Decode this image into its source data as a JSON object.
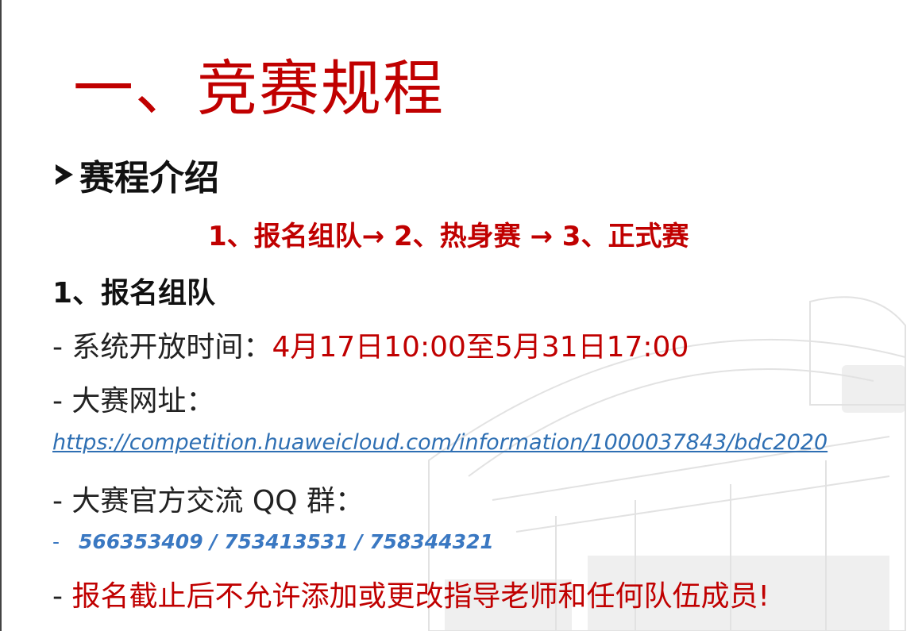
{
  "slide": {
    "title": "一、竞赛规程",
    "section_heading": "赛程介绍",
    "flow": "1、报名组队→ 2、热身赛 → 3、正式赛",
    "sub_heading": "1、报名组队",
    "open_time_label": "- 系统开放时间：",
    "open_time_value": "4月17日10:00至5月31日17:00",
    "site_label": "- 大赛网址：",
    "site_url": "https://competition.huaweicloud.com/information/1000037843/bdc2020",
    "qq_label": "- 大赛官方交流 QQ 群：",
    "qq_dash": "-",
    "qq_numbers": "566353409 / 753413531 / 758344321",
    "warning_dash": "- ",
    "warning": "报名截止后不允许添加或更改指导老师和任何队伍成员!"
  },
  "colors": {
    "accent_red": "#c00000",
    "link_blue": "#2e6fb3",
    "qq_blue": "#3a78c2"
  }
}
